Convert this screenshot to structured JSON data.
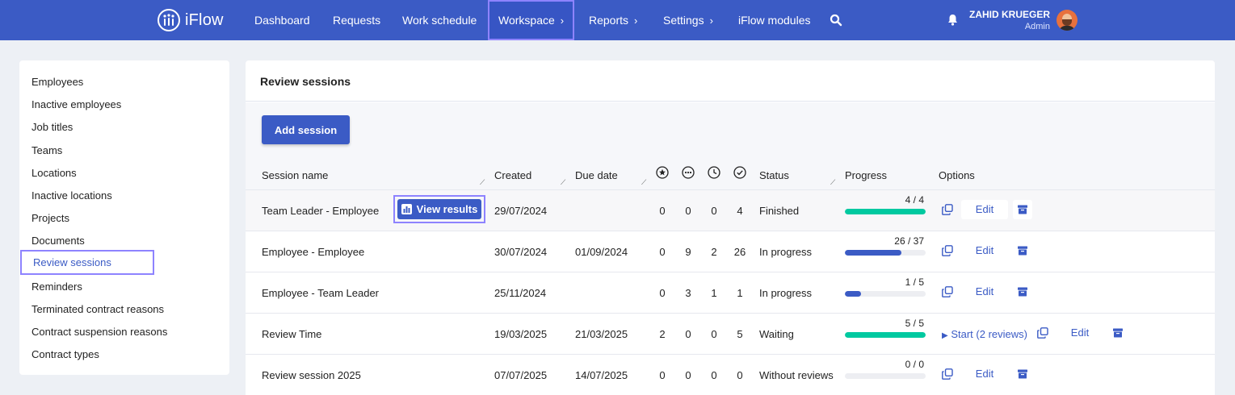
{
  "app": {
    "name": "iFlow"
  },
  "nav": {
    "items": [
      {
        "label": "Dashboard"
      },
      {
        "label": "Requests"
      },
      {
        "label": "Work schedule"
      },
      {
        "label": "Workspace"
      },
      {
        "label": "Reports"
      },
      {
        "label": "Settings"
      },
      {
        "label": "iFlow modules"
      }
    ]
  },
  "user": {
    "name": "ZAHID KRUEGER",
    "role": "Admin"
  },
  "sidebar": {
    "items": [
      {
        "label": "Employees"
      },
      {
        "label": "Inactive employees"
      },
      {
        "label": "Job titles"
      },
      {
        "label": "Teams"
      },
      {
        "label": "Locations"
      },
      {
        "label": "Inactive locations"
      },
      {
        "label": "Projects"
      },
      {
        "label": "Documents"
      },
      {
        "label": "Review sessions"
      },
      {
        "label": "Reminders"
      },
      {
        "label": "Terminated contract reasons"
      },
      {
        "label": "Contract suspension reasons"
      },
      {
        "label": "Contract types"
      }
    ]
  },
  "main": {
    "title": "Review sessions",
    "add_button": "Add session",
    "view_results": "View results",
    "edit_label": "Edit",
    "columns": {
      "session_name": "Session name",
      "created": "Created",
      "due_date": "Due date",
      "status": "Status",
      "progress": "Progress",
      "options": "Options"
    },
    "column_icons": [
      "star-icon",
      "more-icon",
      "clock-icon",
      "check-circle-icon"
    ],
    "rows": [
      {
        "name": "Team Leader - Employee",
        "created": "29/07/2024",
        "due": "",
        "c1": "0",
        "c2": "0",
        "c3": "0",
        "c4": "4",
        "status": "Finished",
        "progress_text": "4 / 4",
        "progress": 1.0,
        "color": "#00c9a0"
      },
      {
        "name": "Employee - Employee",
        "created": "30/07/2024",
        "due": "01/09/2024",
        "c1": "0",
        "c2": "9",
        "c3": "2",
        "c4": "26",
        "status": "In progress",
        "progress_text": "26 / 37",
        "progress": 0.7027,
        "color": "#3b5bc5"
      },
      {
        "name": "Employee - Team Leader",
        "created": "25/11/2024",
        "due": "",
        "c1": "0",
        "c2": "3",
        "c3": "1",
        "c4": "1",
        "status": "In progress",
        "progress_text": "1 / 5",
        "progress": 0.2,
        "color": "#3b5bc5"
      },
      {
        "name": "Review Time",
        "created": "19/03/2025",
        "due": "21/03/2025",
        "c1": "2",
        "c2": "0",
        "c3": "0",
        "c4": "5",
        "status": "Waiting",
        "progress_text": "5 / 5",
        "progress": 1.0,
        "color": "#00c9a0",
        "start_label": "Start",
        "start_count": "(2 reviews)"
      },
      {
        "name": "Review session 2025",
        "created": "07/07/2025",
        "due": "14/07/2025",
        "c1": "0",
        "c2": "0",
        "c3": "0",
        "c4": "0",
        "status": "Without reviews",
        "progress_text": "0 / 0",
        "progress": 0.0,
        "color": "#3b5bc5"
      }
    ]
  },
  "colors": {
    "brand": "#3b5bc5",
    "success": "#00c9a0",
    "highlight": "#8e83ff"
  }
}
